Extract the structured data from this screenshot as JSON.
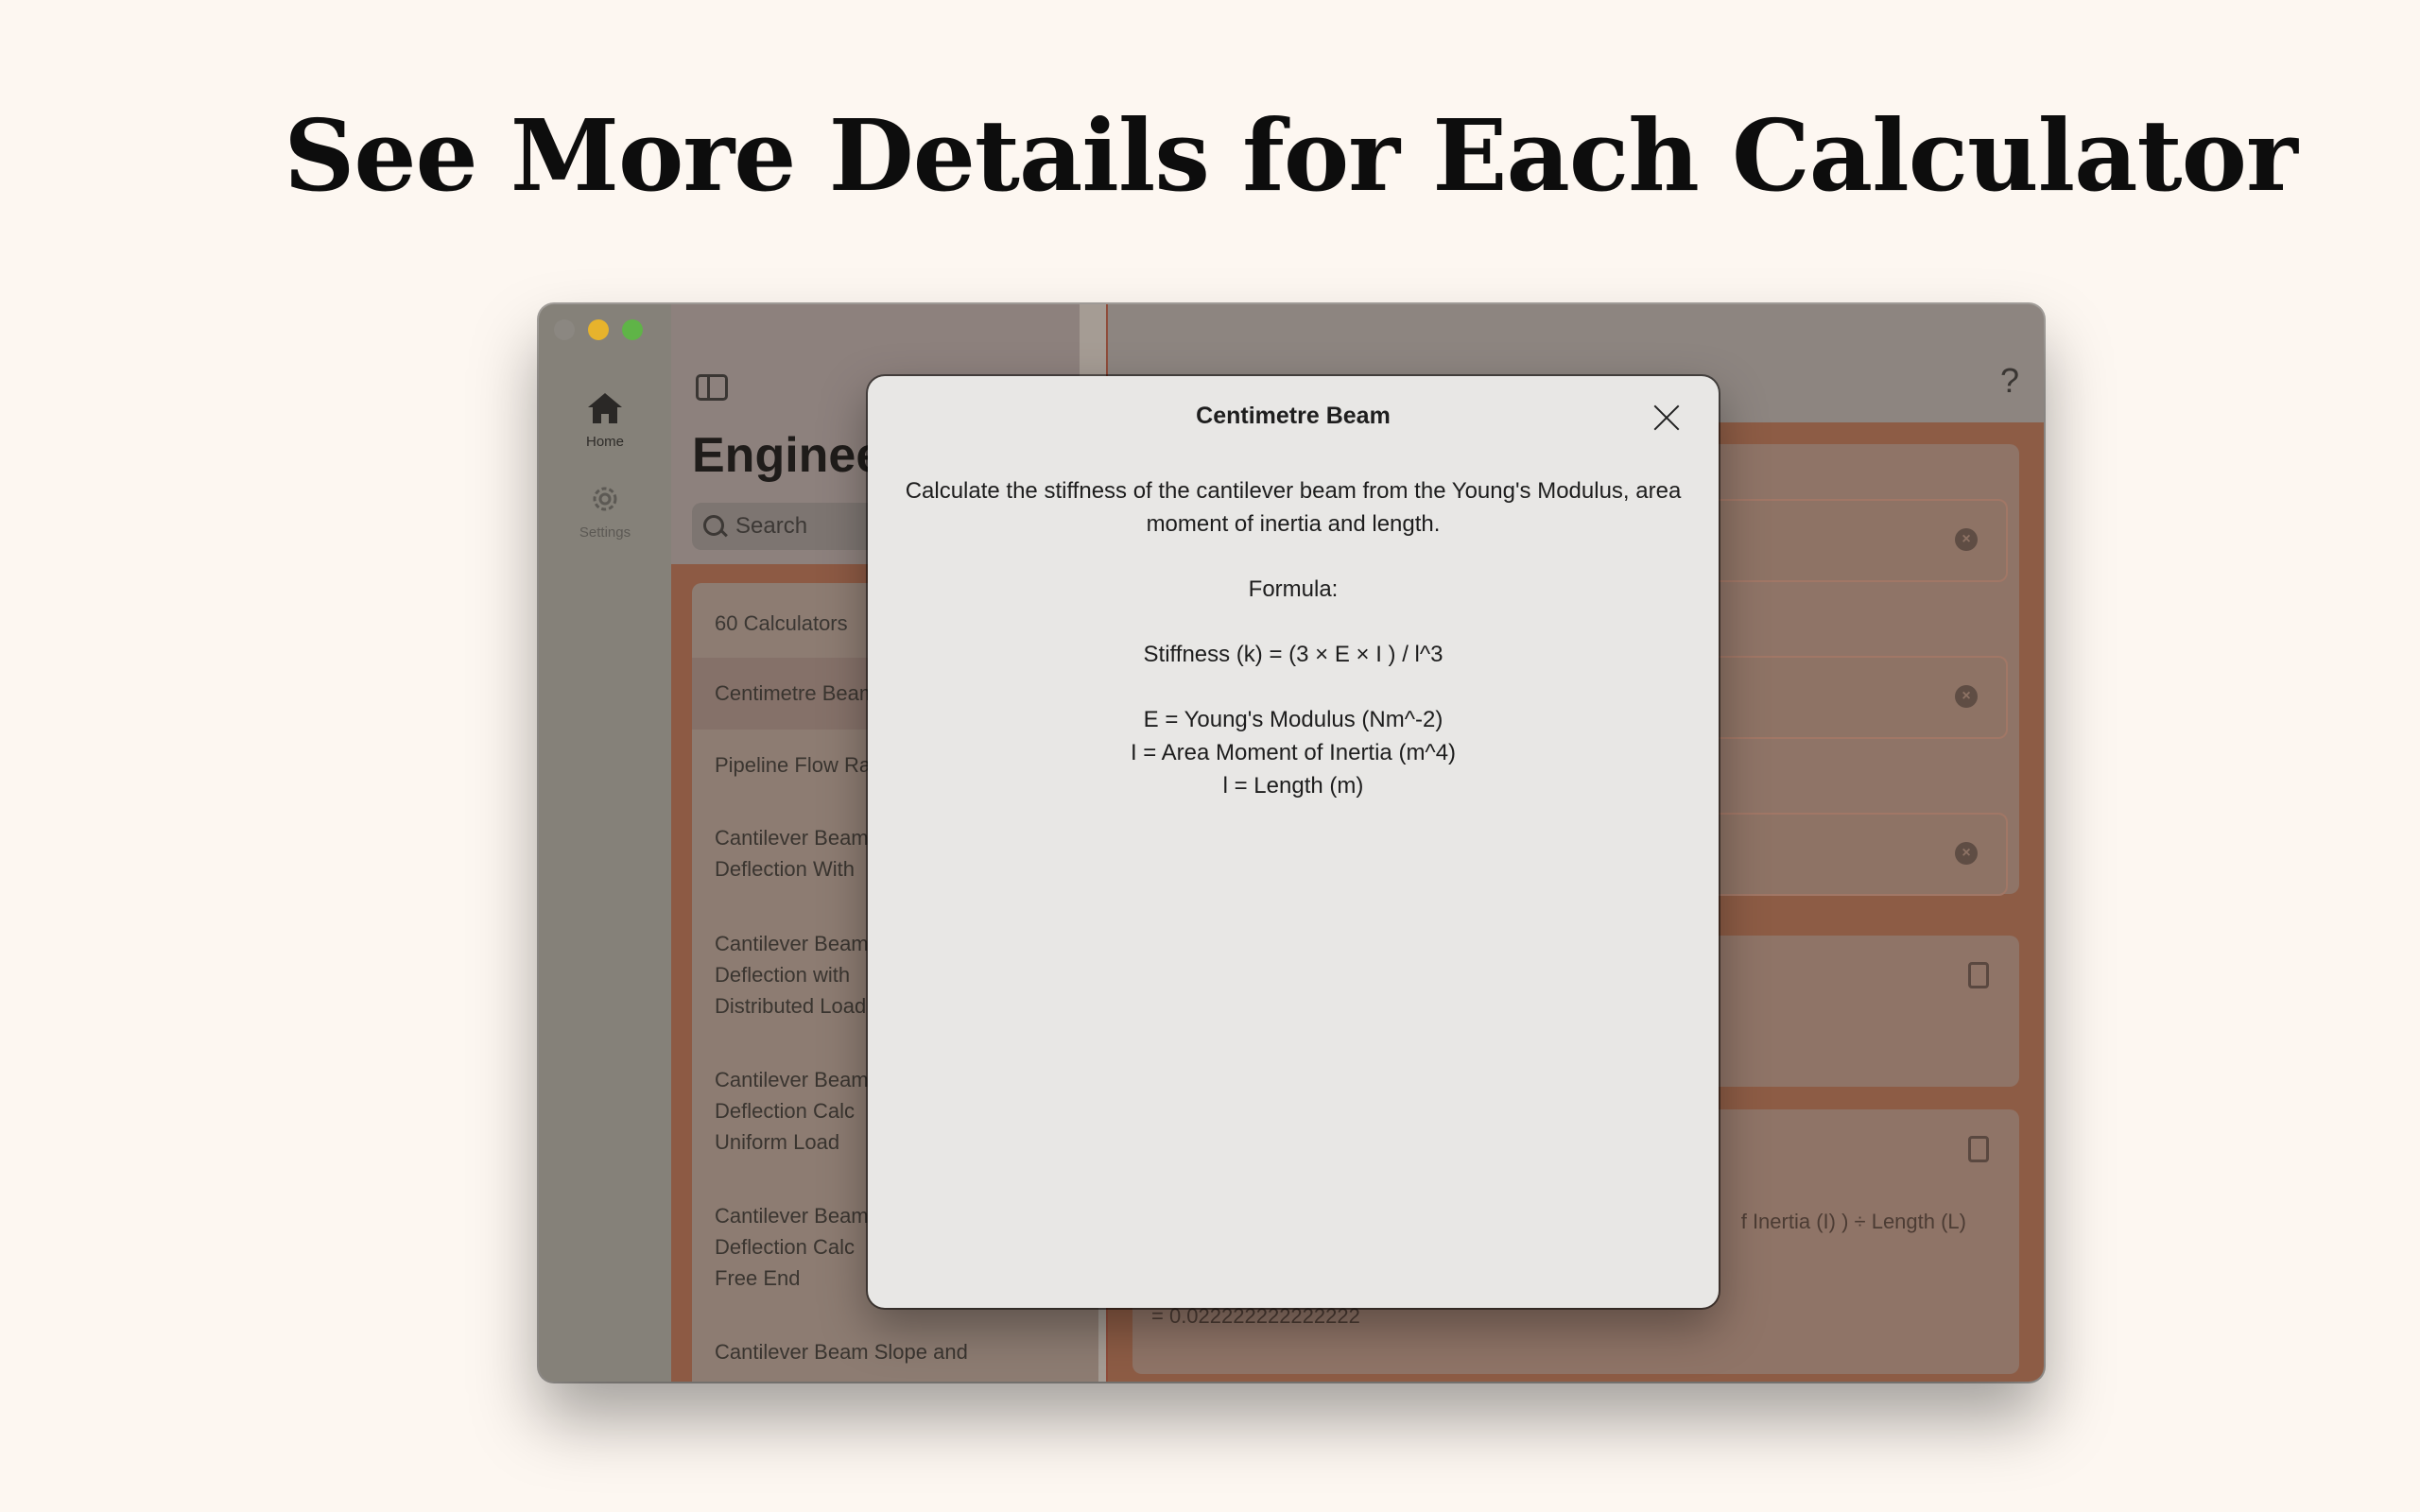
{
  "headline": "See More Details for Each Calculator",
  "sidebar": {
    "home_label": "Home",
    "settings_label": "Settings"
  },
  "list": {
    "app_title": "Engineering Calculators",
    "search_placeholder": "Search",
    "count_header": "60 Calculators",
    "items": [
      {
        "line1": "Centimetre Beam",
        "line2": "",
        "line3": ""
      },
      {
        "line1": "Pipeline Flow Rate",
        "line2": "",
        "line3": ""
      },
      {
        "line1": "Cantilever Beam",
        "line2": "Deflection With",
        "line3": ""
      },
      {
        "line1": "Cantilever Beam",
        "line2": "Deflection with",
        "line3": "Distributed Load"
      },
      {
        "line1": "Cantilever Beam",
        "line2": "Deflection Calc",
        "line3": "Uniform Load"
      },
      {
        "line1": "Cantilever Beam",
        "line2": "Deflection Calc",
        "line3": "Free End"
      },
      {
        "line1": "Cantilever Beam Slope and",
        "line2": "",
        "line3": ""
      }
    ]
  },
  "detail": {
    "formula_text": "f Inertia (I) ) ÷ Length (L)",
    "result_text": "= 0.022222222222222"
  },
  "modal": {
    "title": "Centimetre Beam",
    "description_line1": "Calculate the stiffness of the cantilever beam from the Young's Modulus, area",
    "description_line2": "moment of inertia and length.",
    "formula_heading": "Formula:",
    "formula": "Stiffness (k) = (3 × E × I ) / l^3",
    "var_e": "E = Young's Modulus (Nm^-2)",
    "var_i": "I = Area Moment of Inertia (m^4)",
    "var_l": "l = Length (m)"
  }
}
